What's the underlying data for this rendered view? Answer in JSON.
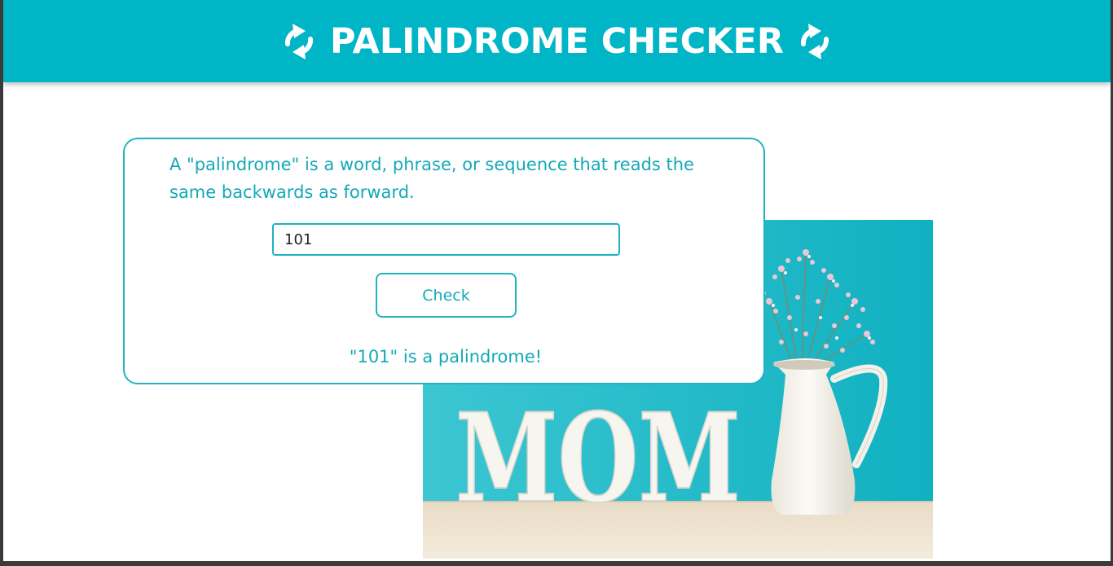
{
  "colors": {
    "accent": "#00b5c5",
    "text_accent": "#14a9b8",
    "background": "#ffffff"
  },
  "header": {
    "title": "PALINDROME CHECKER",
    "left_icon": "swap-arrows-icon",
    "right_icon": "swap-arrows-icon"
  },
  "checker": {
    "description": "A \"palindrome\" is a word, phrase, or sequence that reads the same backwards as forward.",
    "input_value": "101",
    "button_label": "Check",
    "result": "\"101\" is a palindrome!"
  },
  "photo": {
    "letters": "MOM"
  }
}
